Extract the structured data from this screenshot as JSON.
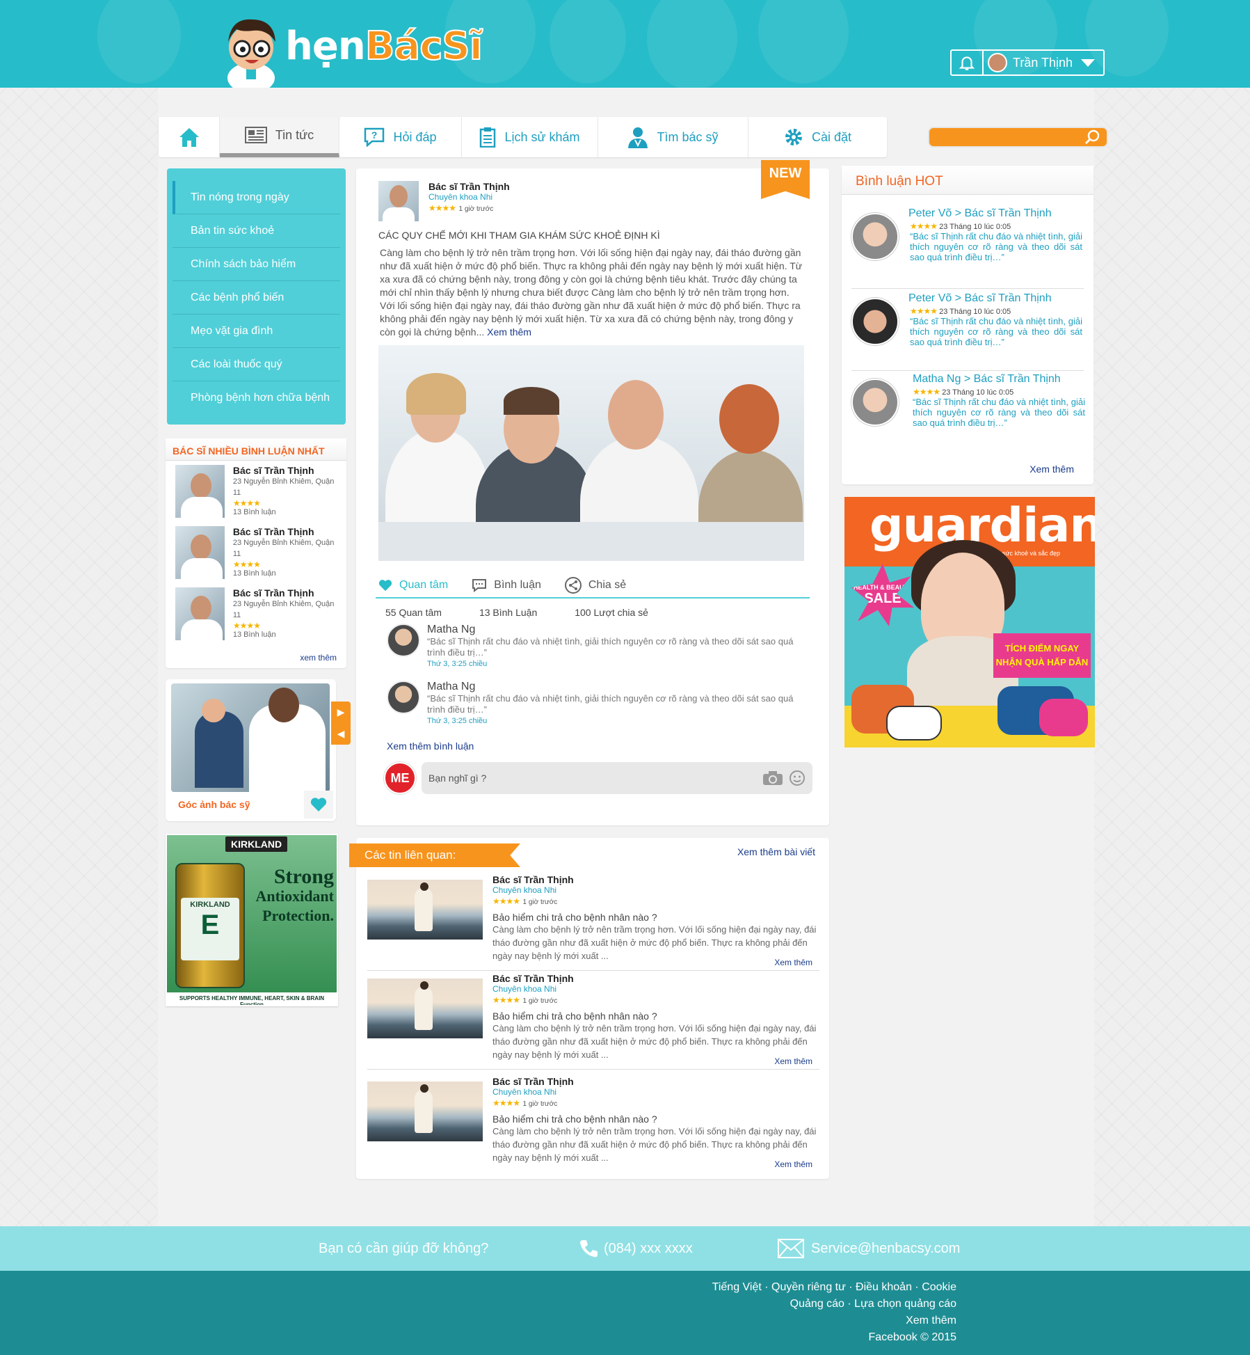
{
  "header": {
    "logo_part1": "hẹn",
    "logo_part2": "BácSĩ",
    "user_name": "Trần Thịnh"
  },
  "nav": {
    "items": [
      {
        "label": ""
      },
      {
        "label": "Tin tức"
      },
      {
        "label": "Hỏi đáp"
      },
      {
        "label": "Lịch sử khám"
      },
      {
        "label": "Tìm bác sỹ"
      },
      {
        "label": "Cài đặt"
      }
    ],
    "search_placeholder": ""
  },
  "left_menu": {
    "items": [
      "Tin nóng trong ngày",
      "Bản tin sức khoẻ",
      "Chính sách bảo hiểm",
      "Các bệnh phổ biến",
      "Mẹo vặt gia đình",
      "Các loài thuốc quý",
      "Phòng bệnh hơn chữa bệnh"
    ]
  },
  "top_doctors": {
    "title": "BÁC SĨ NHIỀU BÌNH LUẬN NHẤT",
    "doctors": [
      {
        "name": "Bác sĩ Trần Thịnh",
        "address": "23 Nguyễn Bỉnh Khiêm, Quận 11",
        "stars": "★★★★",
        "comments": "13 Bình luận"
      },
      {
        "name": "Bác sĩ Trần Thịnh",
        "address": "23 Nguyễn Bỉnh Khiêm, Quận 11",
        "stars": "★★★★",
        "comments": "13 Bình luận"
      },
      {
        "name": "Bác sĩ Trần Thịnh",
        "address": "23 Nguyễn Bỉnh Khiêm, Quận 11",
        "stars": "★★★★",
        "comments": "13 Bình luận"
      }
    ],
    "more": "xem thêm"
  },
  "photo_corner": {
    "label": "Góc ảnh bác sỹ"
  },
  "kirkland_ad": {
    "brand": "KIRKLAND",
    "vitamin": "E",
    "headline1": "Strong",
    "headline2": "Antioxidant Protection.",
    "footer": "SUPPORTS HEALTHY IMMUNE, HEART, SKIN & BRAIN Function"
  },
  "post": {
    "badge": "NEW",
    "author": "Bác sĩ Trần Thịnh",
    "specialty": "Chuyên khoa Nhi",
    "stars": "★★★★",
    "time": "1 giờ trước",
    "title": "CÁC QUY CHẾ MỚI KHI THAM GIA KHÁM SỨC KHOẺ ĐỊNH KÌ",
    "body": "Càng làm cho  bệnh lý trở nên  trầm trọng  hơn. Với lối  sống  hiện đại ngày  nay,  đái tháo đường gần như đã xuất hiện ở mức độ phổ biến. Thực ra không phải đến ngày nay bệnh lý mới xuất hiện. Từ xa xưa đã có chứng bệnh này, trong đông y còn gọi là chứng bệnh tiêu khát. Trước đây chúng ta mới chỉ nhìn thấy bệnh lý nhưng chưa biết được Càng làm cho bệnh lý trở nên  trầm trọng  hơn. Với lối  sống  hiện đại ngày  nay,  đái tháo đường gần như đã xuất hiện ở mức độ phổ biến. Thực ra không phải đến ngày nay bệnh lý mới xuất hiện. Từ xa xưa đã có chứng bệnh này, trong đông y còn gọi là chứng bệnh...",
    "more": "Xem thêm",
    "actions": {
      "like": "Quan tâm",
      "comment": "Bình luận",
      "share": "Chia sẻ"
    },
    "counts": {
      "likes": "55 Quan tâm",
      "comments": "13 Bình Luận",
      "shares": "100 Lượt chia sẻ"
    },
    "comments": [
      {
        "name": "Matha Ng",
        "text": "“Bác sĩ Thịnh rất chu đáo và nhiệt tình, giải thích nguyên cơ rõ ràng và theo dõi sát sao quá trình điều trị…”",
        "date": "Thứ 3, 3:25 chiều"
      },
      {
        "name": "Matha Ng",
        "text": "“Bác sĩ Thịnh rất chu đáo và nhiệt tình, giải thích nguyên cơ rõ ràng và theo dõi sát sao quá trình điều trị…”",
        "date": "Thứ 3, 3:25 chiều"
      }
    ],
    "see_more_comments": "Xem thêm bình luận",
    "me_label": "ME",
    "input_placeholder": "Bạn nghĩ gì ?"
  },
  "related": {
    "title": "Các tin liên quan:",
    "more": "Xem thêm bài viết",
    "items": [
      {
        "author": "Bác sĩ Trần Thịnh",
        "specialty": "Chuyên khoa Nhi",
        "stars": "★★★★",
        "time": "1 giờ trước",
        "question": "Bảo hiểm chi trả cho bệnh nhân nào ?",
        "excerpt": "Càng làm cho  bệnh lý trở nên  trầm trọng  hơn. Với lối  sống  hiện đại ngày  nay,  đái tháo đường gần như đã xuất hiện ở mức độ phổ biến. Thực ra không phải đến ngày nay bệnh lý mới xuất ...",
        "more": "Xem thêm"
      },
      {
        "author": "Bác sĩ Trần Thịnh",
        "specialty": "Chuyên khoa Nhi",
        "stars": "★★★★",
        "time": "1 giờ trước",
        "question": "Bảo hiểm chi trả cho bệnh nhân nào ?",
        "excerpt": "Càng làm cho  bệnh lý trở nên  trầm trọng  hơn. Với lối  sống  hiện đại ngày  nay,  đái tháo đường gần như đã xuất hiện ở mức độ phổ biến. Thực ra không phải đến ngày nay bệnh lý mới xuất ...",
        "more": "Xem thêm"
      },
      {
        "author": "Bác sĩ Trần Thịnh",
        "specialty": "Chuyên khoa Nhi",
        "stars": "★★★★",
        "time": "1 giờ trước",
        "question": "Bảo hiểm chi trả cho bệnh nhân nào ?",
        "excerpt": "Càng làm cho  bệnh lý trở nên  trầm trọng  hơn. Với lối  sống  hiện đại ngày  nay,  đái tháo đường gần như đã xuất hiện ở mức độ phổ biến. Thực ra không phải đến ngày nay bệnh lý mới xuất ...",
        "more": "Xem thêm"
      }
    ]
  },
  "hot_comments": {
    "title": "Bình luận HOT",
    "items": [
      {
        "name": "Peter Võ > Bác sĩ Trần Thịnh",
        "stars": "★★★★",
        "date": "23 Tháng 10 lúc 0:05",
        "text": "“Bác sĩ Thịnh rất chu đáo và nhiệt tình, giải thích nguyên cơ rõ ràng và theo dõi sát sao quá trình điều trị…”"
      },
      {
        "name": "Peter Võ > Bác sĩ Trần Thịnh",
        "stars": "★★★★",
        "date": "23 Tháng 10 lúc 0:05",
        "text": "“Bác sĩ Thịnh rất chu đáo và nhiệt tình, giải thích nguyên cơ rõ ràng và theo dõi sát sao quá trình điều trị…”"
      },
      {
        "name": "Matha Ng > Bác sĩ Trần Thịnh",
        "stars": "★★★★",
        "date": "23 Tháng 10 lúc 0:05",
        "text": "“Bác sĩ Thịnh rất chu đáo và nhiệt tình, giải thích nguyên cơ rõ ràng và theo dõi sát sao quá trình điều trị…”"
      }
    ],
    "more": "Xem thêm"
  },
  "guardian_ad": {
    "brand": "guardian",
    "tagline": "sức khoẻ và sắc đẹp",
    "sale_top": "HEALTH & BEAUTY",
    "sale": "SALE",
    "promo1": "TÍCH ĐIỂM NGAY",
    "promo2": "NHẬN QUÀ HẤP DẪN"
  },
  "footer": {
    "help": "Bạn có cần giúp đỡ không?",
    "phone": "(084) xxx xxxx",
    "email": "Service@henbacsy.com",
    "links1": "Tiếng Việt · Quyền riêng tư · Điều khoản · Cookie",
    "links2": "Quảng cáo · Lựa chọn quảng cáo",
    "links3": "Xem thêm",
    "copyright": "Facebook © 2015"
  },
  "colors": {
    "brand_teal": "#27bcc9",
    "accent_orange": "#f7941d",
    "menu_teal": "#50cfd8",
    "footer_light": "#8fe0e4",
    "footer_dark": "#1e8d93",
    "link_blue": "#1a3b8b"
  }
}
